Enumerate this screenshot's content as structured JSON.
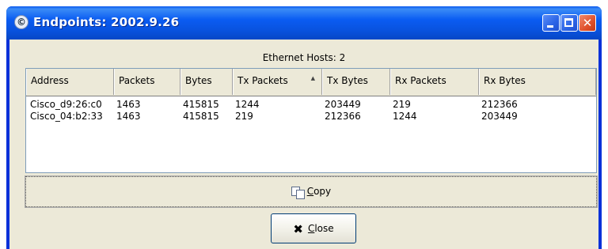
{
  "window": {
    "title": "Endpoints: 2002.9.26",
    "app_icon_glyph": "©"
  },
  "titlebar_buttons": {
    "close_glyph": "✕"
  },
  "caption": "Ethernet Hosts: 2",
  "table": {
    "columns": [
      "Address",
      "Packets",
      "Bytes",
      "Tx Packets",
      "Tx Bytes",
      "Rx Packets",
      "Rx Bytes"
    ],
    "sort_indicator": "▲",
    "rows": [
      [
        "Cisco_d9:26:c0",
        "1463",
        "415815",
        "1244",
        "203449",
        "219",
        "212366"
      ],
      [
        "Cisco_04:b2:33",
        "1463",
        "415815",
        "219",
        "212366",
        "1244",
        "203449"
      ]
    ]
  },
  "buttons": {
    "copy": {
      "accel": "C",
      "rest": "opy"
    },
    "close": {
      "accel": "C",
      "rest": "lose",
      "icon_glyph": "✖"
    }
  }
}
